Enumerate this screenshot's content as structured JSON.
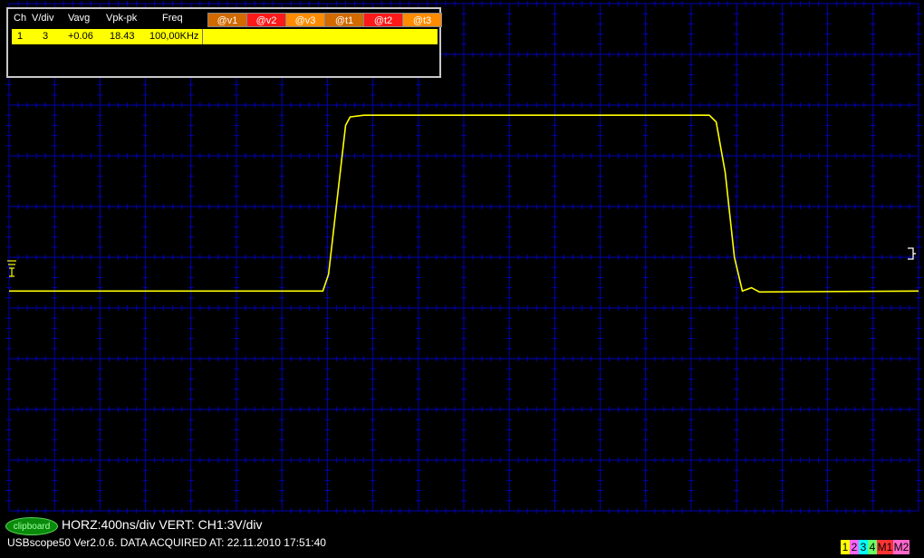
{
  "measurement_table": {
    "headers": {
      "ch": "Ch",
      "vdiv": "V/div",
      "vavg": "Vavg",
      "vpkpk": "Vpk-pk",
      "freq": "Freq"
    },
    "markers": [
      {
        "label": "@v1",
        "color": "#d26a00"
      },
      {
        "label": "@v2",
        "color": "#ff1a1a"
      },
      {
        "label": "@v3",
        "color": "#ff8c00"
      },
      {
        "label": "@t1",
        "color": "#d26a00"
      },
      {
        "label": "@t2",
        "color": "#ff1a1a"
      },
      {
        "label": "@t3",
        "color": "#ff8c00"
      }
    ],
    "row": {
      "ch": "1",
      "vdiv": "3",
      "vavg": "+0.06",
      "vpkpk": "18.43",
      "freq": "100,00KHz"
    }
  },
  "footer": {
    "clipboard_label": "clipboard",
    "horz_vert": "HORZ:400ns/div VERT: CH1:3V/div",
    "status": "USBscope50 Ver2.0.6.  DATA ACQUIRED AT: 22.11.2010 17:51:40"
  },
  "channels": [
    {
      "label": "1",
      "color": "#ffff00"
    },
    {
      "label": "2",
      "color": "#ff66ff"
    },
    {
      "label": "3",
      "color": "#00ffff"
    },
    {
      "label": "4",
      "color": "#66ff66"
    },
    {
      "label": "M1",
      "color": "#ff3333"
    },
    {
      "label": "M2",
      "color": "#ff66cc"
    }
  ],
  "colors": {
    "grid": "#0000b4",
    "trace": "#ffff00",
    "background": "#000000"
  },
  "trace": {
    "comment_units": "time in microseconds relative to screen start, voltage in volts",
    "points": [
      [
        0.0,
        -2.0
      ],
      [
        2.76,
        -2.0
      ],
      [
        2.81,
        -1.0
      ],
      [
        2.96,
        7.8
      ],
      [
        3.0,
        8.3
      ],
      [
        3.12,
        8.4
      ],
      [
        6.16,
        8.4
      ],
      [
        6.22,
        8.0
      ],
      [
        6.3,
        5.0
      ],
      [
        6.38,
        0.0
      ],
      [
        6.45,
        -2.0
      ],
      [
        6.53,
        -1.8
      ],
      [
        6.6,
        -2.05
      ],
      [
        8.0,
        -2.0
      ]
    ]
  }
}
